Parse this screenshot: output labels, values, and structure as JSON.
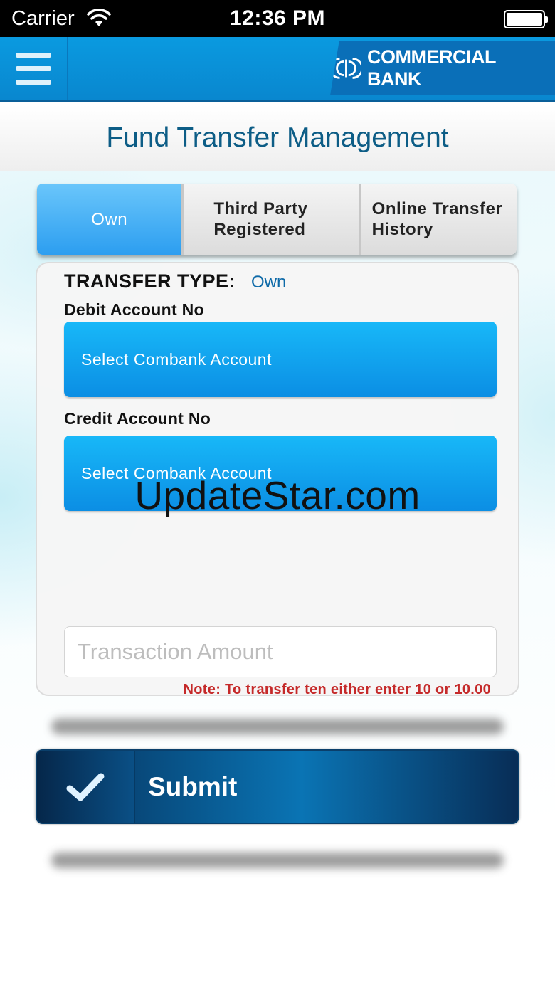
{
  "status_bar": {
    "carrier": "Carrier",
    "time": "12:36 PM"
  },
  "header": {
    "logo_text": "COMMERCIAL BANK"
  },
  "page": {
    "title": "Fund Transfer Management"
  },
  "tabs": [
    {
      "label": "Own",
      "active": true
    },
    {
      "label": "Third Party\nRegistered",
      "active": false
    },
    {
      "label": "Online Transfer\nHistory",
      "active": false
    }
  ],
  "form": {
    "transfer_type_label": "TRANSFER TYPE:",
    "transfer_type_value": "Own",
    "debit_label": "Debit Account No",
    "debit_select": "Select Combank Account",
    "credit_label": "Credit Account No",
    "credit_select": "Select Combank Account",
    "amount_placeholder": "Transaction Amount",
    "note": "Note: To transfer ten either enter 10 or 10.00"
  },
  "submit": {
    "label": "Submit"
  },
  "watermark": "UpdateStar.com",
  "colors": {
    "header_blue": "#0a9ae0",
    "logo_blue": "#0a6fb8",
    "title_text": "#0d5d86",
    "select_blue": "#18b8f8",
    "note_red": "#c52a2a",
    "submit_dark": "#062e57"
  }
}
